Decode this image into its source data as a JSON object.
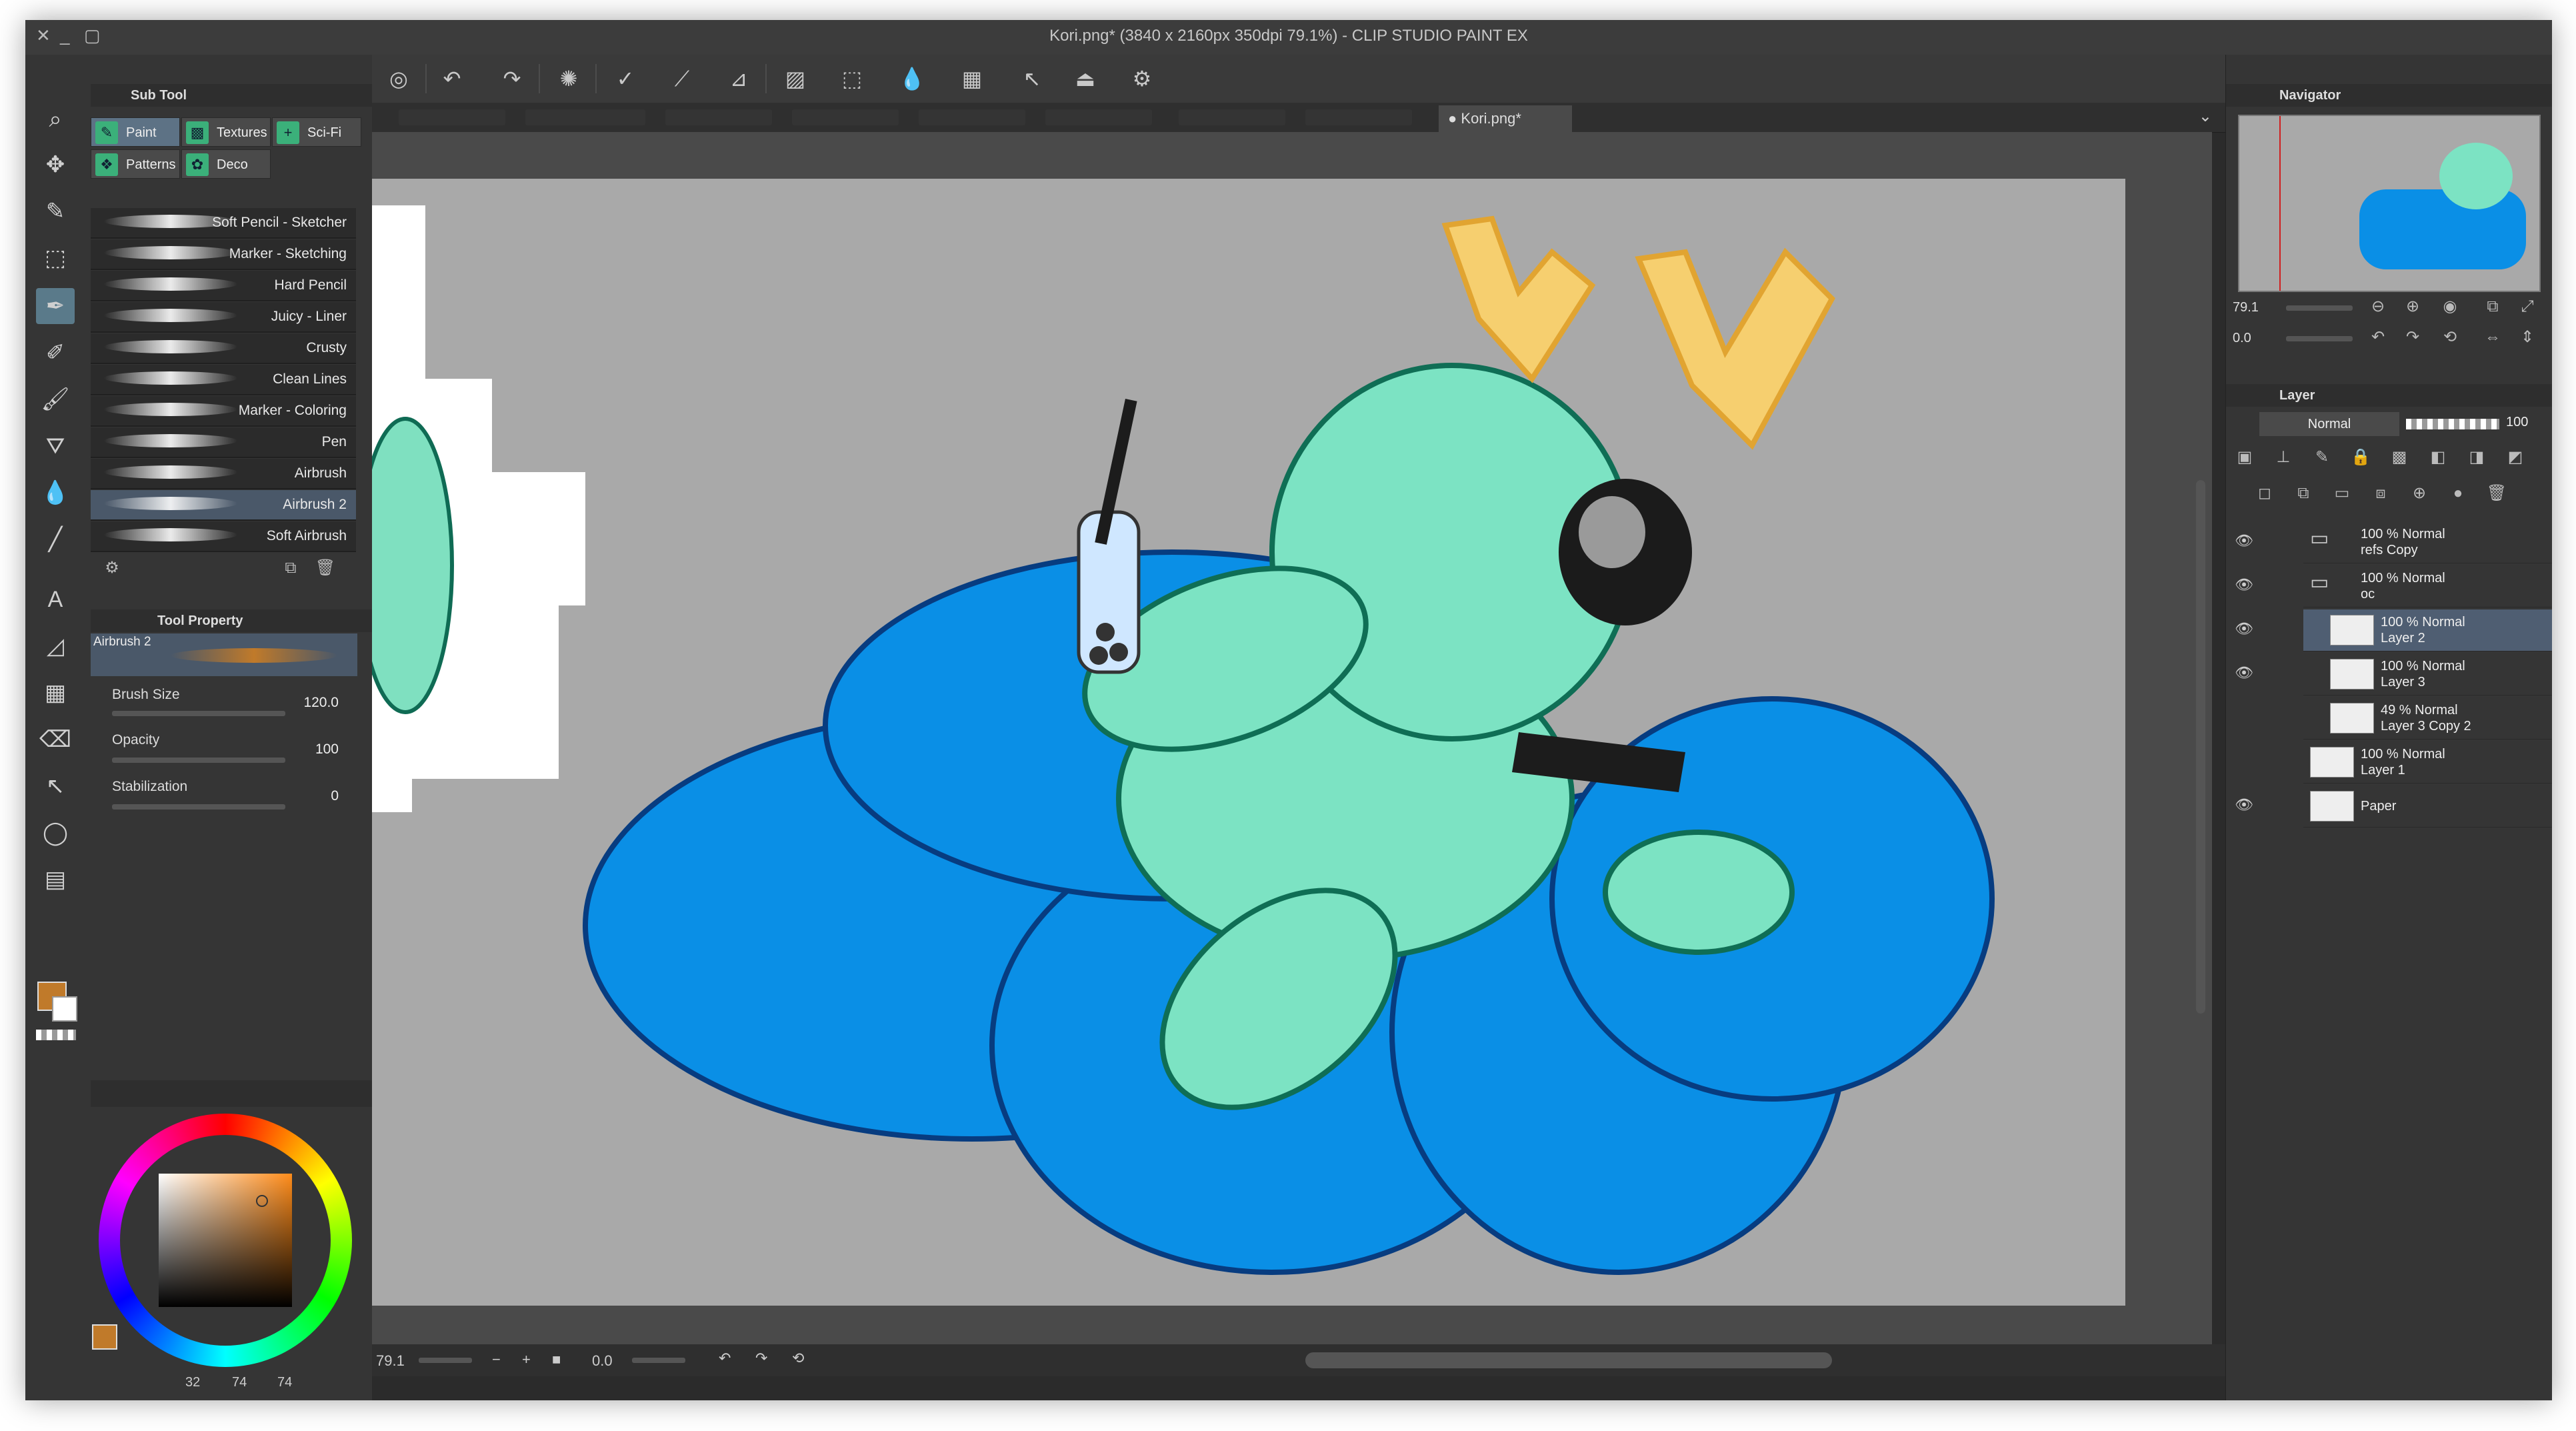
{
  "window": {
    "title": "Kori.png* (3840 x 2160px 350dpi 79.1%)  - CLIP STUDIO PAINT EX"
  },
  "tabs": {
    "active": "Kori.png*"
  },
  "subtool": {
    "header": "Sub Tool",
    "groups": [
      "Paint",
      "Textures",
      "Sci-Fi",
      "Patterns",
      "Deco"
    ],
    "brushes": [
      "Soft Pencil - Sketcher",
      "Marker - Sketching",
      "Hard Pencil",
      "Juicy - Liner",
      "Crusty",
      "Clean Lines",
      "Marker - Coloring",
      "Pen",
      "Airbrush",
      "Airbrush 2",
      "Soft Airbrush"
    ],
    "selected": "Airbrush 2"
  },
  "toolprop": {
    "header": "Tool Property",
    "tool_name": "Airbrush 2",
    "brush_size_label": "Brush Size",
    "brush_size": "120.0",
    "opacity_label": "Opacity",
    "opacity": "100",
    "stabilization_label": "Stabilization",
    "stabilization": "0"
  },
  "color": {
    "main": "#c07a2a",
    "sub": "#ffffff",
    "values": {
      "a": "32",
      "b": "74",
      "c": "74"
    }
  },
  "navigator": {
    "header": "Navigator",
    "zoom": "79.1",
    "rotation": "0.0"
  },
  "layerpanel": {
    "header": "Layer",
    "blend": "Normal",
    "opacity": "100"
  },
  "layers": [
    {
      "pct": "100 %",
      "mode": "Normal",
      "name": "refs Copy",
      "visible": true,
      "folder": true
    },
    {
      "pct": "100 %",
      "mode": "Normal",
      "name": "oc",
      "visible": true,
      "folder": true
    },
    {
      "pct": "100 %",
      "mode": "Normal",
      "name": "Layer 2",
      "visible": true,
      "selected": true
    },
    {
      "pct": "100 %",
      "mode": "Normal",
      "name": "Layer 3",
      "visible": true
    },
    {
      "pct": "49 %",
      "mode": "Normal",
      "name": "Layer 3 Copy 2",
      "visible": false
    },
    {
      "pct": "100 %",
      "mode": "Normal",
      "name": "Layer 1",
      "visible": false
    },
    {
      "pct": "",
      "mode": "",
      "name": "Paper",
      "visible": true
    }
  ],
  "status": {
    "zoom": "79.1",
    "rotation": "0.0"
  },
  "icons": {
    "toolbar": [
      "lasso-icon",
      "undo-icon",
      "redo-icon",
      "loading-icon",
      "pen-check-icon",
      "brush-icon",
      "ruler-icon",
      "diagonal-fill-icon",
      "transform-icon",
      "drops-icon",
      "grid-icon",
      "pointer-icon",
      "stamp-icon",
      "gear-icon"
    ]
  }
}
